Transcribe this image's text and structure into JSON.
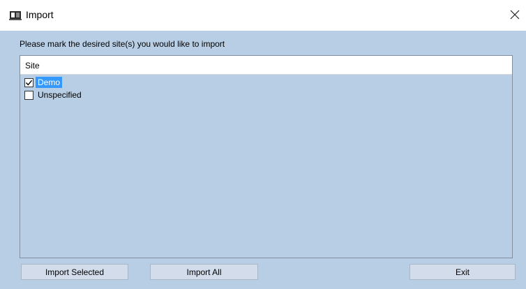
{
  "window": {
    "title": "Import",
    "icon": "import-app-icon",
    "close_icon": "close-icon"
  },
  "main": {
    "instruction": "Please mark the desired site(s) you would like to import",
    "list": {
      "column_header": "Site",
      "items": [
        {
          "label": "Demo",
          "checked": true,
          "selected": true
        },
        {
          "label": "Unspecified",
          "checked": false,
          "selected": false
        }
      ]
    }
  },
  "buttons": {
    "import_selected": "Import Selected",
    "import_all": "Import All",
    "exit": "Exit"
  },
  "colors": {
    "client_background": "#b8cee4",
    "selection": "#3399ff",
    "button_face": "#d2dcea"
  }
}
